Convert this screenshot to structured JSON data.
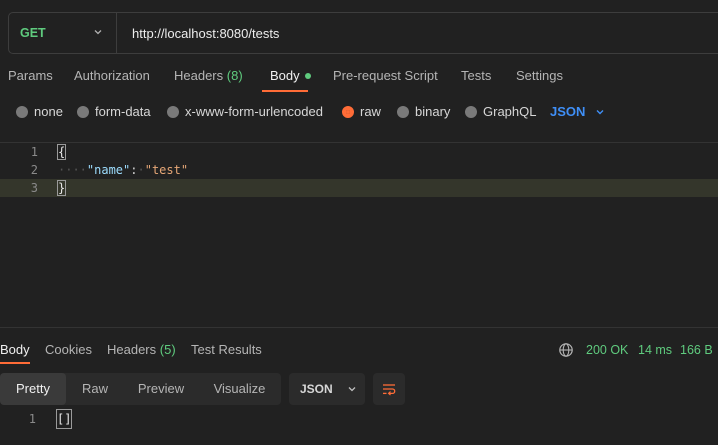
{
  "request": {
    "method": "GET",
    "url": "http://localhost:8080/tests"
  },
  "tabs": {
    "params": "Params",
    "authorization": "Authorization",
    "headers": "Headers",
    "headers_count": "(8)",
    "body": "Body",
    "prerequest": "Pre-request Script",
    "tests": "Tests",
    "settings": "Settings"
  },
  "body_types": {
    "none": "none",
    "form_data": "form-data",
    "urlencoded": "x-www-form-urlencoded",
    "raw": "raw",
    "binary": "binary",
    "graphql": "GraphQL",
    "selected": "raw",
    "language": "JSON"
  },
  "editor": {
    "lines": [
      {
        "no": "1",
        "text": "{"
      },
      {
        "no": "2",
        "key": "\"name\"",
        "colon": ":",
        "value": "\"test\""
      },
      {
        "no": "3",
        "text": "}"
      }
    ]
  },
  "response": {
    "tabs": {
      "body": "Body",
      "cookies": "Cookies",
      "headers": "Headers",
      "headers_count": "(5)",
      "test_results": "Test Results"
    },
    "status": "200 OK",
    "time": "14 ms",
    "size": "166 B",
    "format": {
      "pretty": "Pretty",
      "raw": "Raw",
      "preview": "Preview",
      "visualize": "Visualize",
      "language": "JSON"
    },
    "lines": [
      {
        "no": "1",
        "text": "[]"
      }
    ]
  },
  "colors": {
    "accent": "#ff6c37",
    "method": "#5fcb7e",
    "link": "#3f8ff7"
  }
}
